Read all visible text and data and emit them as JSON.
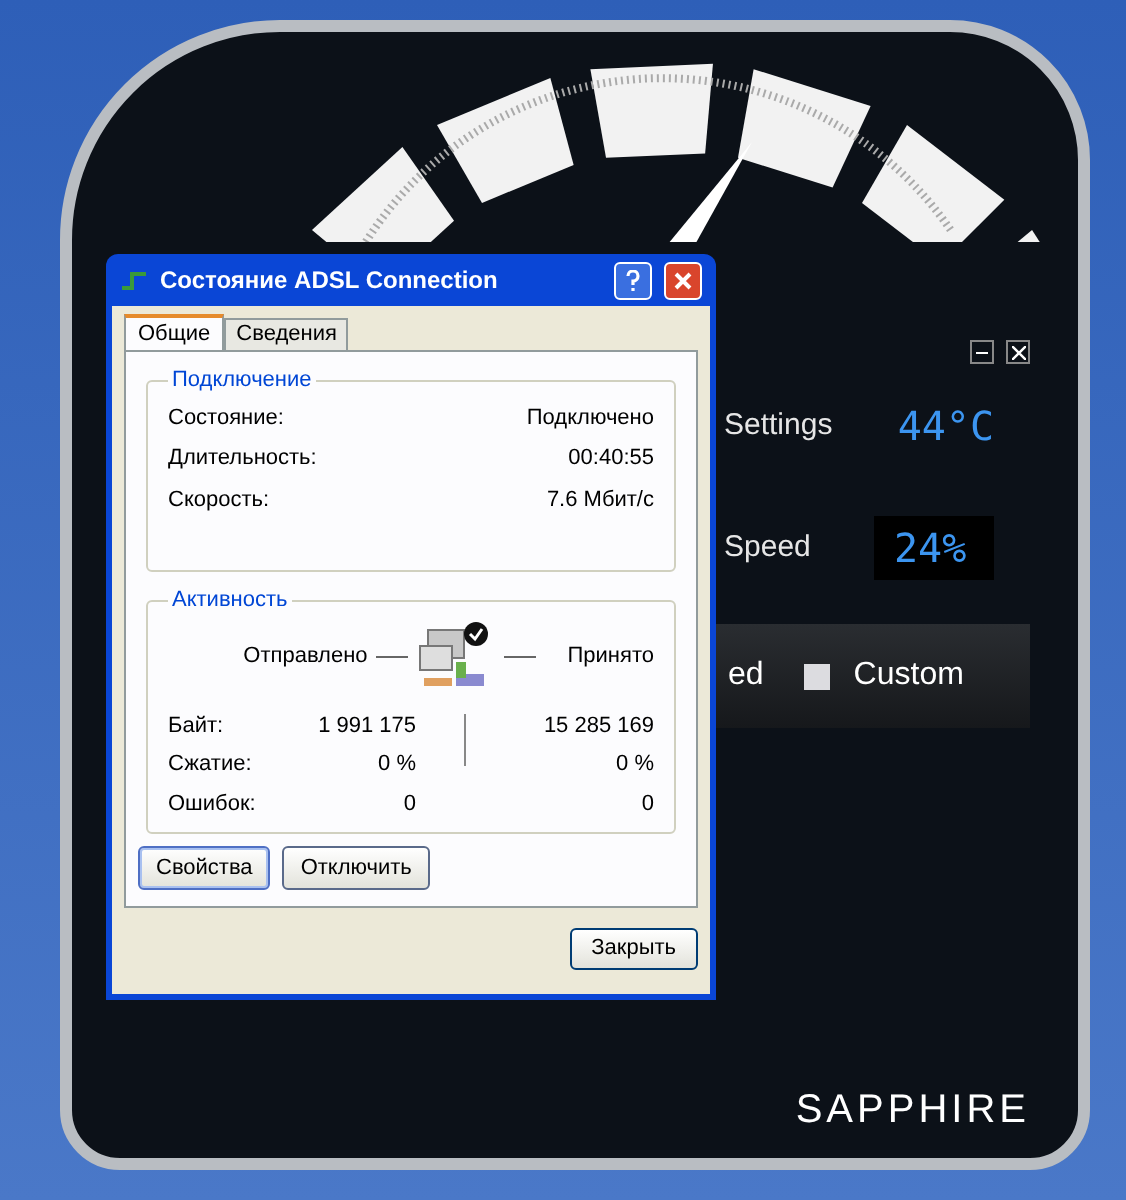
{
  "app": {
    "temperature_label": "Settings",
    "temperature": "44°C",
    "fan_label": "Speed",
    "fan_speed": "24%",
    "fan_mode_text": "ed",
    "custom_option": {
      "label": "Custom",
      "checked": false
    },
    "brand": "SAPPHIRE"
  },
  "dialog": {
    "title": "Состояние ADSL Connection",
    "tabs": [
      {
        "label": "Общие",
        "selected": true
      },
      {
        "label": "Сведения",
        "selected": false
      }
    ],
    "connection": {
      "title": "Подключение",
      "rows": [
        {
          "label": "Состояние:",
          "value": "Подключено"
        },
        {
          "label": "Длительность:",
          "value": "00:40:55"
        },
        {
          "label": "Скорость:",
          "value": "7.6 Мбит/с"
        }
      ]
    },
    "activity": {
      "title": "Активность",
      "sent_label": "Отправлено",
      "received_label": "Принято",
      "rows": [
        {
          "label": "Байт:",
          "sent": "1 991 175",
          "received": "15 285 169"
        },
        {
          "label": "Сжатие:",
          "sent": "0 %",
          "received": "0 %"
        },
        {
          "label": "Ошибок:",
          "sent": "0",
          "received": "0"
        }
      ]
    },
    "buttons": [
      {
        "label": "Свойства",
        "focused": true
      },
      {
        "label": "Отключить",
        "focused": false
      }
    ],
    "close_button": "Закрыть"
  }
}
